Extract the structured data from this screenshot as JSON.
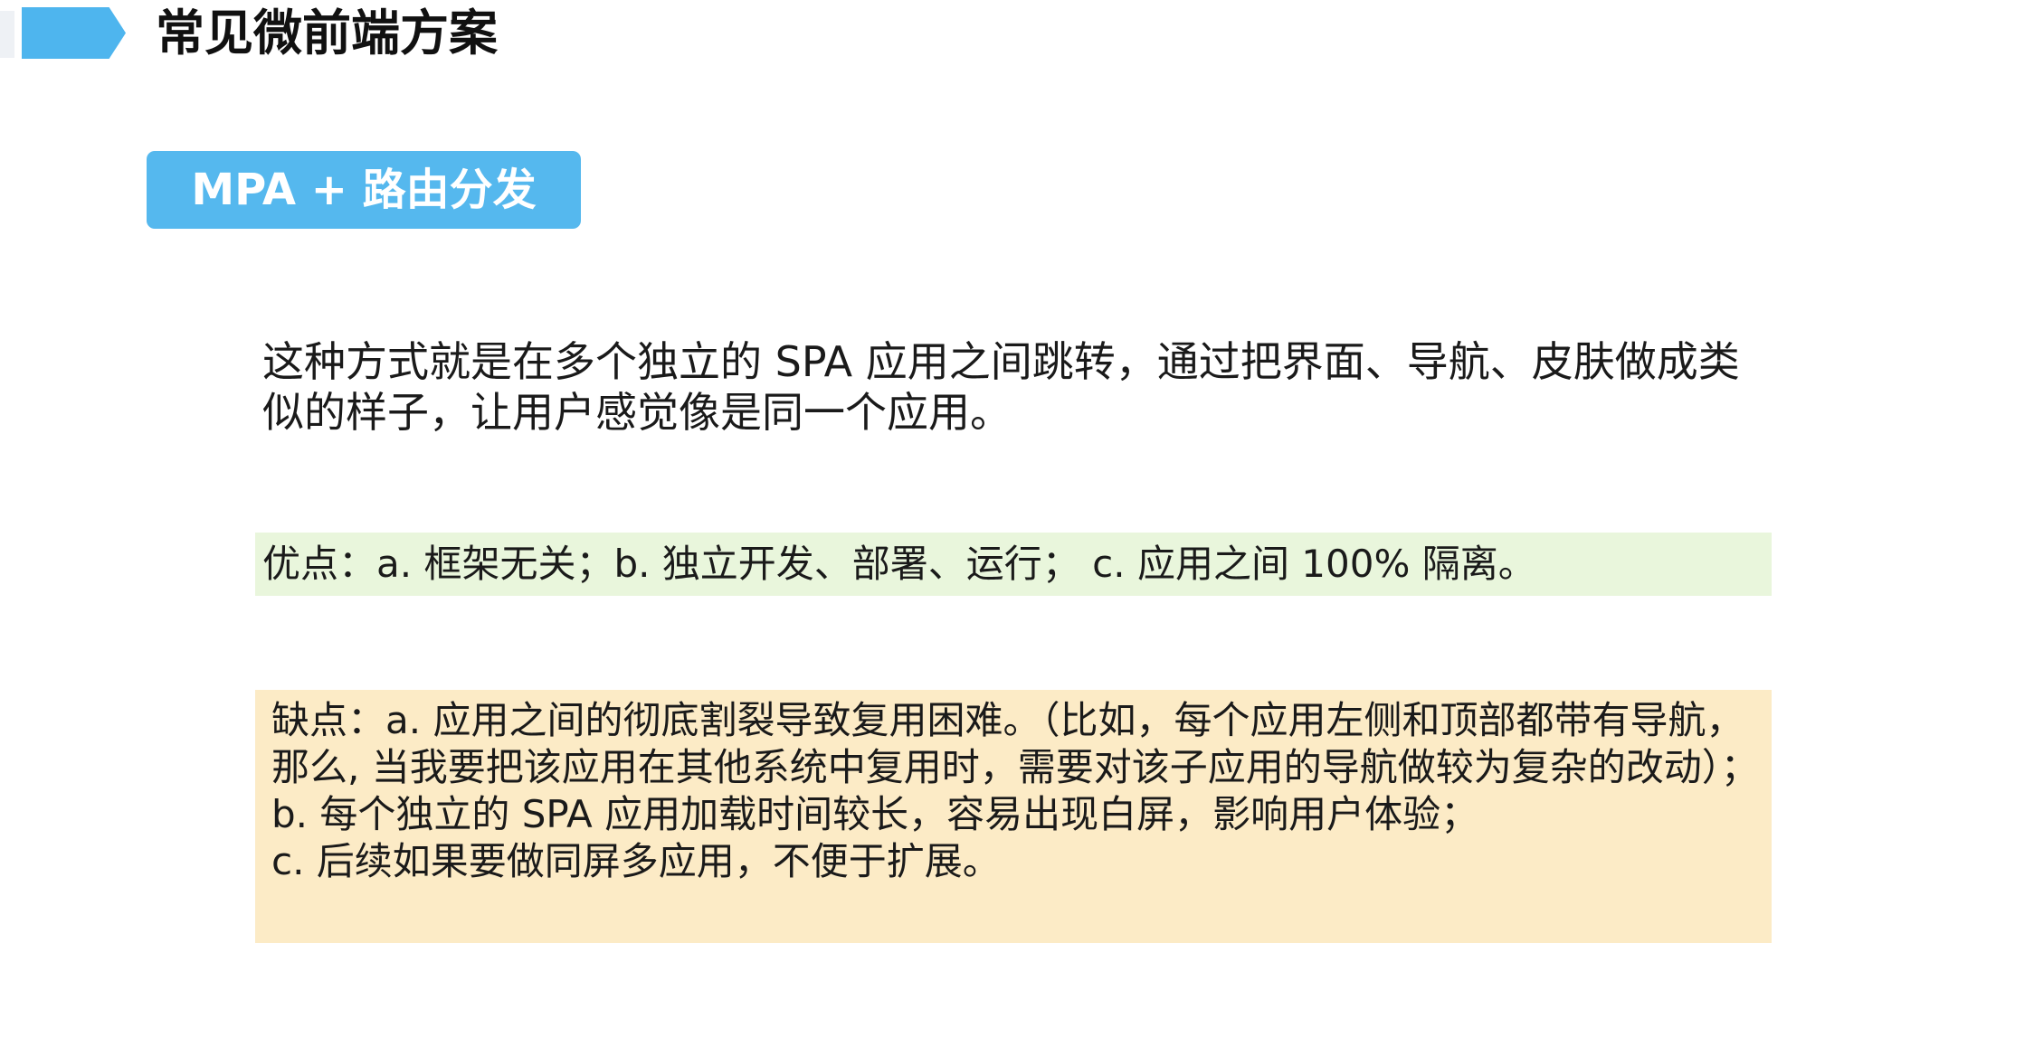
{
  "header": {
    "title": "常见微前端方案"
  },
  "badge": {
    "label": "MPA + 路由分发"
  },
  "intro": {
    "text": "这种方式就是在多个独立的 SPA 应用之间跳转，通过把界面、导航、皮肤做成类似的样子，让用户感觉像是同一个应用。"
  },
  "pros": {
    "text": "优点：a. 框架无关；b. 独立开发、部署、运行； c. 应用之间 100% 隔离。"
  },
  "cons": {
    "line_a": "缺点：a. 应用之间的彻底割裂导致复用困难。（比如，每个应用左侧和顶部都带有导航，那么, 当我要把该应用在其他系统中复用时，需要对该子应用的导航做较为复杂的改动）；",
    "line_b": "b. 每个独立的 SPA 应用加载时间较长，容易出现白屏，影响用户体验；",
    "line_c": "c. 后续如果要做同屏多应用，不便于扩展。"
  },
  "colors": {
    "accent_blue": "#4eb5ee",
    "pros_background": "#e9f6dc",
    "cons_background": "#fcebc6"
  }
}
